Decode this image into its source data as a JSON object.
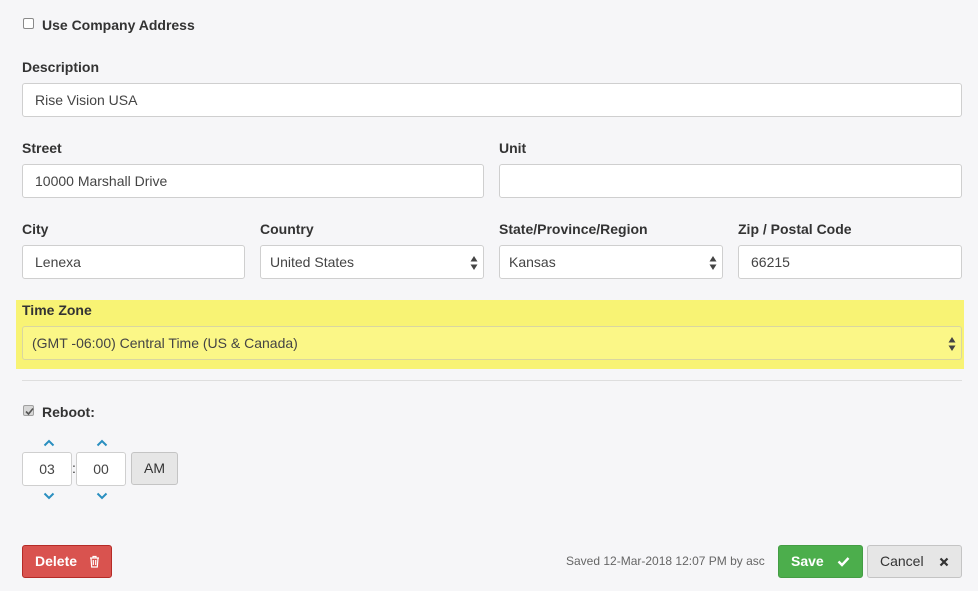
{
  "use_company_address": {
    "label": "Use Company Address",
    "checked": false
  },
  "description": {
    "label": "Description",
    "value": "Rise Vision USA"
  },
  "street": {
    "label": "Street",
    "value": "10000 Marshall Drive"
  },
  "unit": {
    "label": "Unit",
    "value": ""
  },
  "city": {
    "label": "City",
    "value": "Lenexa"
  },
  "country": {
    "label": "Country",
    "value": "United States"
  },
  "state": {
    "label": "State/Province/Region",
    "value": "Kansas"
  },
  "zip": {
    "label": "Zip / Postal Code",
    "value": "66215"
  },
  "time_zone": {
    "label": "Time Zone",
    "value": "(GMT -06:00) Central Time (US & Canada)"
  },
  "reboot": {
    "label": "Reboot:",
    "checked": true,
    "hour": "03",
    "separator": ":",
    "minute": "00",
    "meridian": "AM"
  },
  "footer": {
    "delete_label": "Delete",
    "saved_status": "Saved 12-Mar-2018 12:07 PM by asc",
    "save_label": "Save",
    "cancel_label": "Cancel"
  },
  "colors": {
    "delete_bg": "#d9534f",
    "save_bg": "#4cae4c",
    "highlight": "#f8f374",
    "spinner_arrow": "#2a8fc0"
  },
  "icons": {
    "delete": "trash-icon",
    "save": "check-icon",
    "cancel": "close-icon",
    "select": "updown-arrows-icon",
    "spinner_up": "chevron-up-icon",
    "spinner_down": "chevron-down-icon"
  }
}
